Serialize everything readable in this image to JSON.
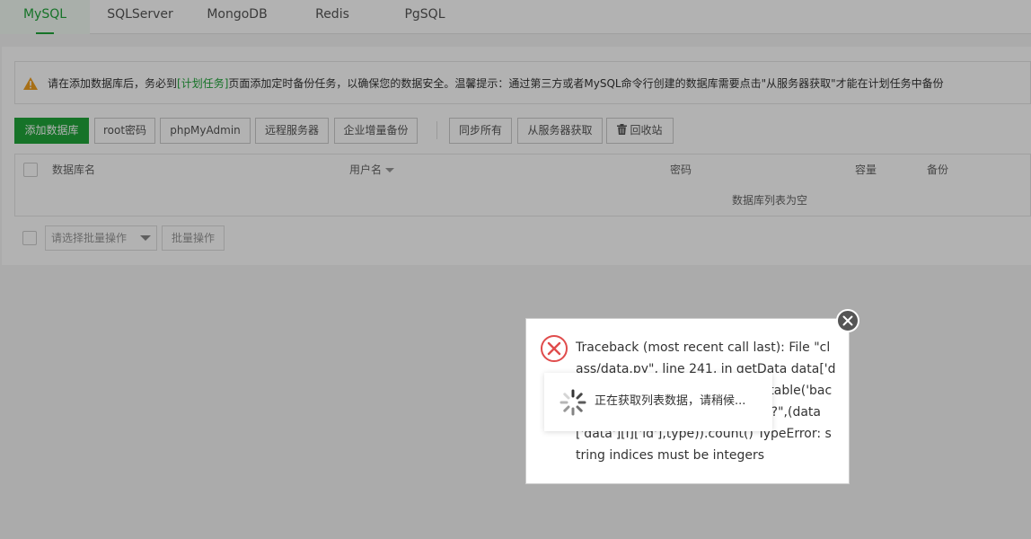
{
  "tabs": [
    "MySQL",
    "SQLServer",
    "MongoDB",
    "Redis",
    "PgSQL"
  ],
  "active_tab": "MySQL",
  "alert": {
    "icon": "warning-icon",
    "prefix": "请在添加数据库后，务必到",
    "link": "[计划任务]",
    "suffix": "页面添加定时备份任务，以确保您的数据安全。温馨提示：通过第三方或者MySQL命令行创建的数据库需要点击\"从服务器获取\"才能在计划任务中备份"
  },
  "toolbar": {
    "add_db": "添加数据库",
    "root_password": "root密码",
    "phpmyadmin": "phpMyAdmin",
    "remote_server": "远程服务器",
    "incremental_backup": "企业增量备份",
    "sync_all": "同步所有",
    "fetch_from_server": "从服务器获取",
    "recycle_bin": "回收站"
  },
  "table": {
    "columns": [
      "数据库名",
      "用户名",
      "密码",
      "容量",
      "备份"
    ],
    "empty_text": "数据库列表为空"
  },
  "batch": {
    "placeholder": "请选择批量操作",
    "button": "批量操作"
  },
  "error_dialog": {
    "icon": "error-icon",
    "message": "Traceback (most recent call last): File \"class/data.py\", line 241, in getData data['data'][i]['backup_count'] = SQL.table('backup').where(\"pid=? AND type=?\",(data['data'][i]['id'],type)).count() TypeError: string indices must be integers"
  },
  "loading": {
    "text": "正在获取列表数据，请稍候..."
  },
  "colors": {
    "accent": "#20a53a",
    "error": "#e04c4c",
    "warning": "#f0a020"
  }
}
